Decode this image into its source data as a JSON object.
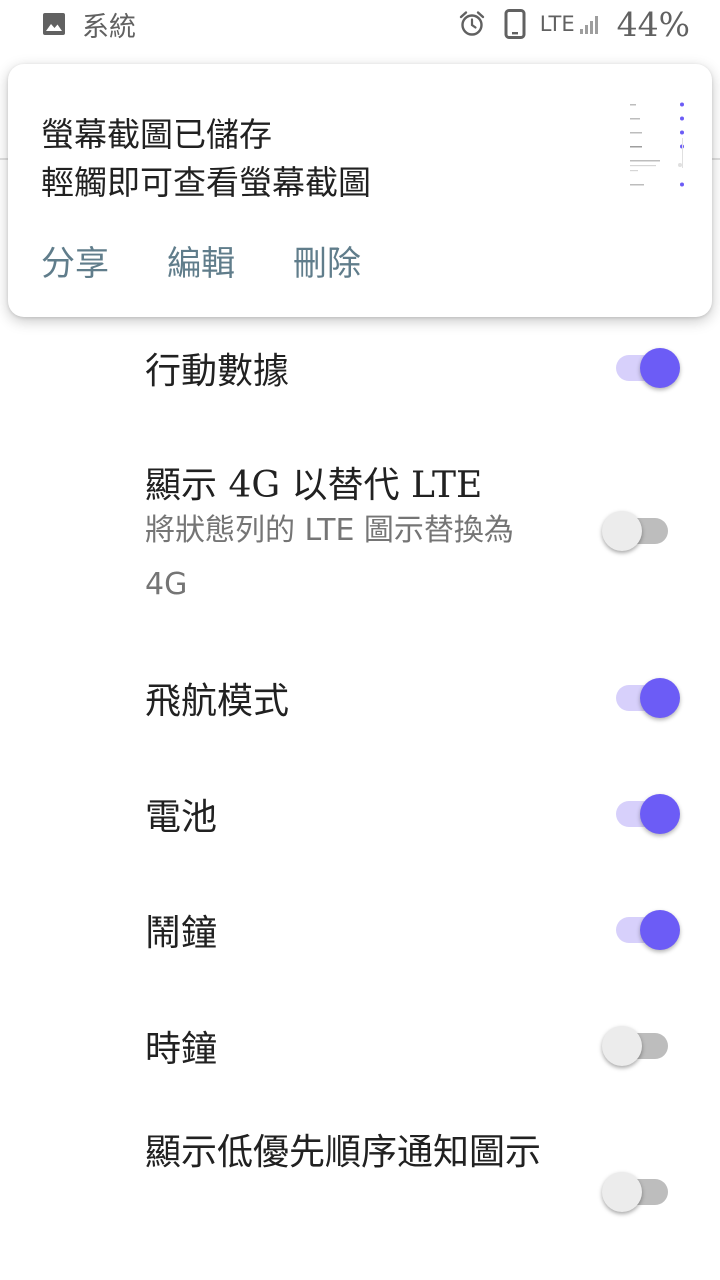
{
  "status_bar": {
    "app_icon": "image-icon",
    "app_label": "系統",
    "alarm_icon": "alarm-clock-icon",
    "phone_icon": "phone-icon",
    "network": "LTE",
    "signal_icon": "signal-bars-icon",
    "battery": "44%"
  },
  "notification": {
    "title": "螢幕截圖已儲存",
    "text": "輕觸即可查看螢幕截圖",
    "actions": [
      "分享",
      "編輯",
      "刪除"
    ],
    "accent": "#607d8b"
  },
  "settings": [
    {
      "title": "行動數據",
      "on": true
    },
    {
      "title": "顯示 4G 以替代 LTE",
      "summary": "將狀態列的 LTE 圖示替換為 4G",
      "on": false
    },
    {
      "title": "飛航模式",
      "on": true
    },
    {
      "title": "電池",
      "on": true
    },
    {
      "title": "鬧鐘",
      "on": true
    },
    {
      "title": "時鐘",
      "on": false
    },
    {
      "title": "顯示低優先順序通知圖示",
      "on": false
    }
  ],
  "colors": {
    "switch_on_thumb": "#6c5cf6",
    "switch_on_track": "#d7d0fb",
    "switch_off_thumb": "#ececec",
    "switch_off_track": "#bdbdbd"
  }
}
